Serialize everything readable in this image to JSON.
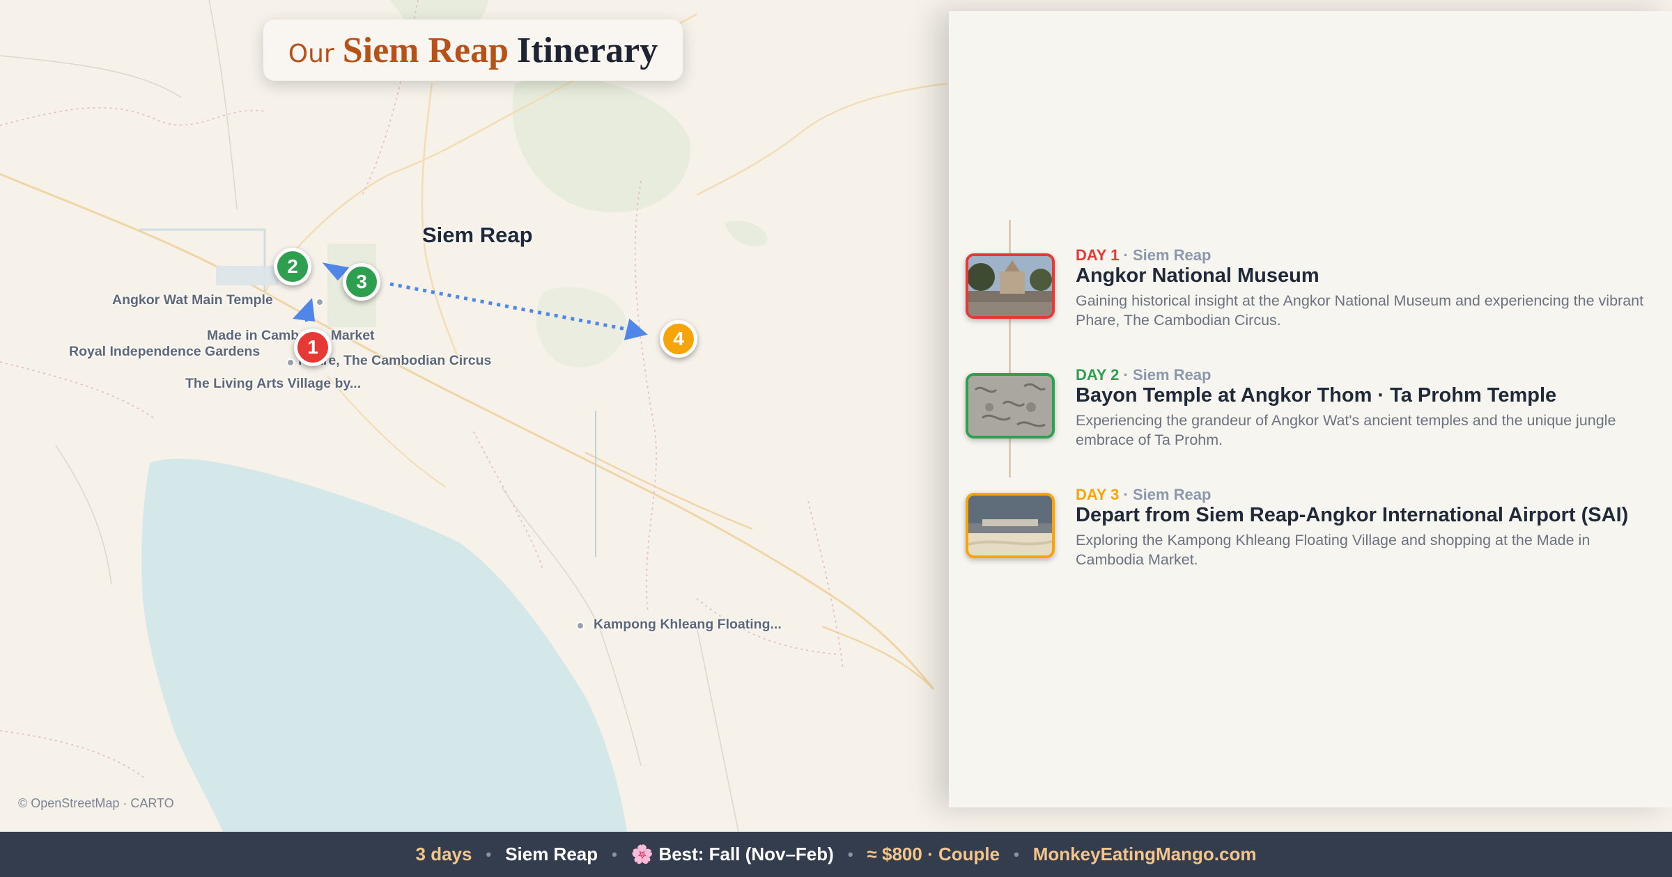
{
  "title": {
    "prefix": "Our",
    "city": "Siem Reap",
    "rest": "Itinerary"
  },
  "map": {
    "city_label": "Siem Reap",
    "attribution": "© OpenStreetMap · CARTO",
    "poi_labels": [
      "Angkor Wat Main Temple",
      "Made in Cambodia Market",
      "Royal Independence Gardens",
      "Phare, The Cambodian Circus",
      "The Living Arts Village by...",
      "Kampong Khleang Floating..."
    ],
    "markers": [
      {
        "label": "1",
        "color": "#e53935"
      },
      {
        "label": "2",
        "color": "#2e9e4f"
      },
      {
        "label": "3",
        "color": "#2e9e4f"
      },
      {
        "label": "4",
        "color": "#f5a50a"
      }
    ],
    "colors": {
      "water": "#d4e7e9",
      "land": "#f6f2ea",
      "park": "#dfe8d3",
      "route": "#4f86e8"
    }
  },
  "days": [
    {
      "day": "DAY 1",
      "sep": " · ",
      "location": "Siem Reap",
      "color": "#e53935",
      "title": "Angkor National Museum",
      "description": "Gaining historical insight at the Angkor National Museum and experiencing the vibrant Phare, The Cambodian Circus."
    },
    {
      "day": "DAY 2",
      "sep": " · ",
      "location": "Siem Reap",
      "color": "#2e9e4f",
      "title": "Bayon Temple at Angkor Thom · Ta Prohm Temple",
      "description": "Experiencing the grandeur of Angkor Wat's ancient temples and the unique jungle embrace of Ta Prohm."
    },
    {
      "day": "DAY 3",
      "sep": " · ",
      "location": "Siem Reap",
      "color": "#f5a50a",
      "title": "Depart from Siem Reap-Angkor International Airport (SAI)",
      "description": "Exploring the Kampong Khleang Floating Village and shopping at the Made in Cambodia Market."
    }
  ],
  "footer": {
    "days": "3 days",
    "city": "Siem Reap",
    "best": "🌸 Best: Fall (Nov–Feb)",
    "cost": "≈ $800 · Couple",
    "site": "MonkeyEatingMango.com",
    "separator": "•"
  }
}
